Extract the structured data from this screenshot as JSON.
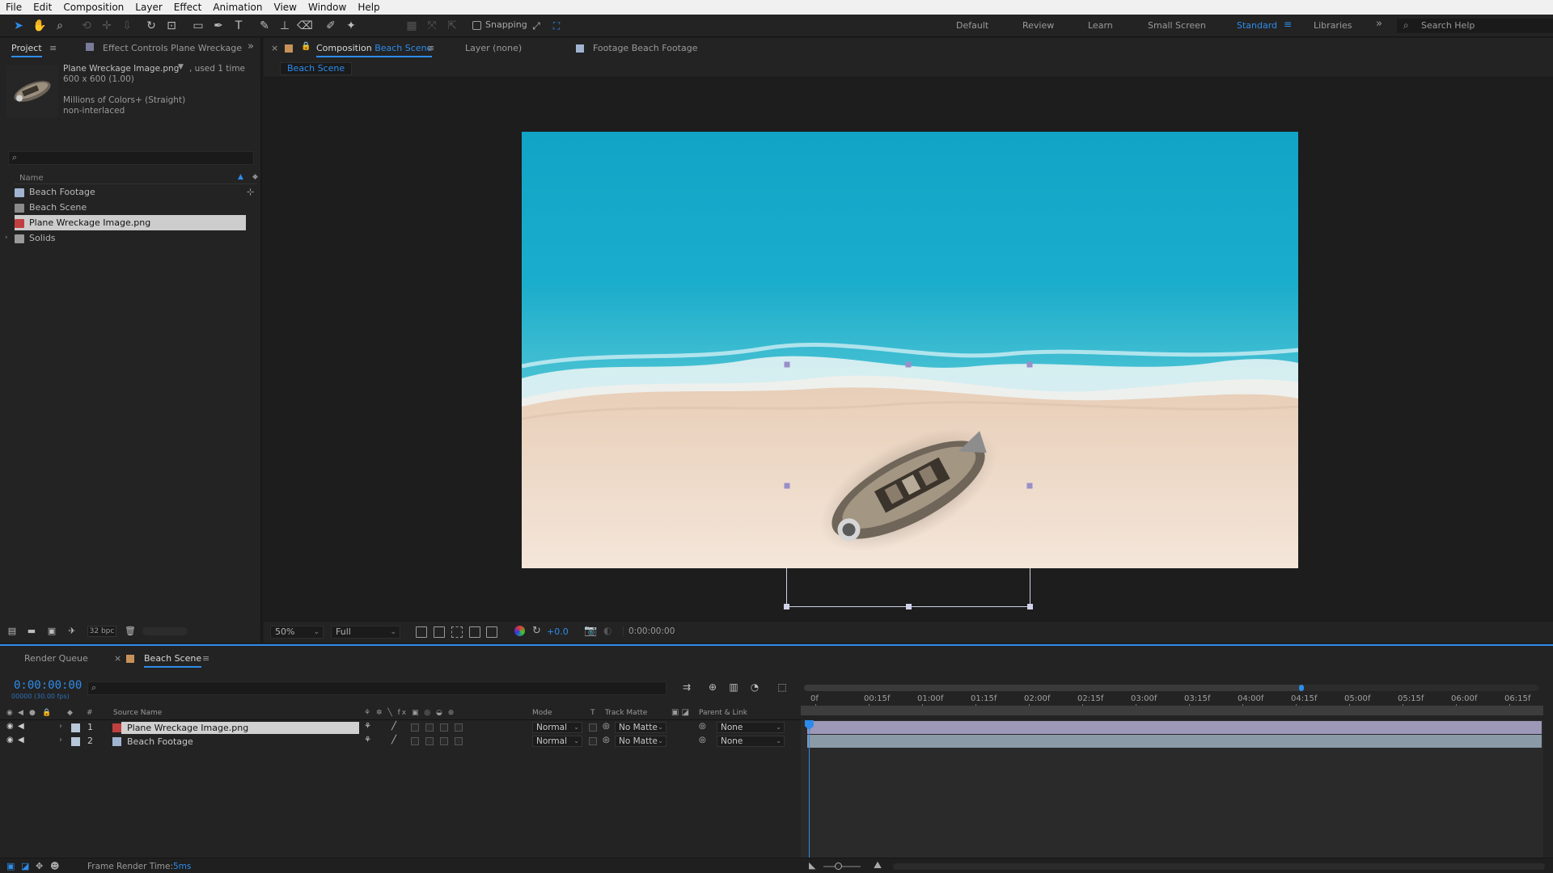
{
  "menu": [
    "File",
    "Edit",
    "Composition",
    "Layer",
    "Effect",
    "Animation",
    "View",
    "Window",
    "Help"
  ],
  "toolbar": {
    "snapping_label": "Snapping",
    "workspaces": [
      "Default",
      "Review",
      "Learn",
      "Small Screen",
      "Standard",
      "Libraries"
    ],
    "active_workspace": "Standard",
    "search_help_placeholder": "Search Help"
  },
  "project_panel": {
    "tab_project": "Project",
    "tab_effect_controls": "Effect Controls Plane Wreckage",
    "selected_info": {
      "name": "Plane Wreckage Image.png",
      "usage": ", used 1 time",
      "dimensions": "600 x 600 (1.00)",
      "colors": "Millions of Colors+ (Straight)",
      "interlace": "non-interlaced"
    },
    "list_header": "Name",
    "items": [
      {
        "name": "Beach Footage",
        "type": "footage",
        "color": "#a0b4d0"
      },
      {
        "name": "Beach Scene",
        "type": "composition",
        "color": "#8a8a8a"
      },
      {
        "name": "Plane Wreckage Image.png",
        "type": "image",
        "color": "#c04040"
      },
      {
        "name": "Solids",
        "type": "folder",
        "color": "#9a9a9a"
      }
    ],
    "selected_item": "Plane Wreckage Image.png",
    "bit_depth": "32 bpc"
  },
  "composition_panel": {
    "tab_composition_prefix": "Composition",
    "tab_composition_name": "Beach Scene",
    "tab_layer": "Layer (none)",
    "tab_footage_prefix": "Footage",
    "tab_footage_name": "Beach Footage",
    "breadcrumb": "Beach Scene",
    "zoom": "50%",
    "resolution": "Full",
    "exposure": "+0.0",
    "timecode": "0:00:00:00"
  },
  "timeline": {
    "tab_render_queue": "Render Queue",
    "tab_comp": "Beach Scene",
    "current_time": "0:00:00:00",
    "fps_label": "00000 (30.00 fps)",
    "columns": {
      "source_name": "Source Name",
      "mode": "Mode",
      "t": "T",
      "track_matte": "Track Matte",
      "parent_link": "Parent & Link"
    },
    "ruler_labels": [
      "0f",
      "00:15f",
      "01:00f",
      "01:15f",
      "02:00f",
      "02:15f",
      "03:00f",
      "03:15f",
      "04:00f",
      "04:15f",
      "05:00f",
      "05:15f",
      "06:00f",
      "06:15f"
    ],
    "layers": [
      {
        "index": "1",
        "name": "Plane Wreckage Image.png",
        "mode": "Normal",
        "matte": "No Matte",
        "parent": "None",
        "label_color": "#b7c8d8",
        "bar_color": "#9d97b8"
      },
      {
        "index": "2",
        "name": "Beach Footage",
        "mode": "Normal",
        "matte": "No Matte",
        "parent": "None",
        "label_color": "#b7c8d8",
        "bar_color": "#8a9aa6"
      }
    ],
    "frame_render_time_label": "Frame Render Time:",
    "frame_render_time_value": "5ms"
  },
  "colors": {
    "accent": "#2d8ceb",
    "panel": "#232323",
    "background": "#1d1d1d"
  }
}
